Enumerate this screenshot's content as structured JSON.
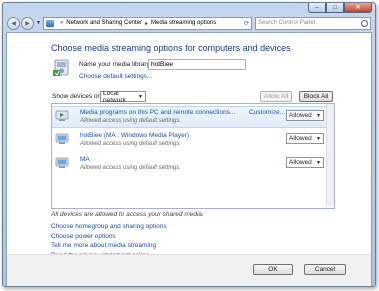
{
  "window": {
    "caption_buttons": [
      "minimize",
      "maximize",
      "close"
    ]
  },
  "navbar": {
    "crumbs": [
      "Network and Sharing Center",
      "Media streaming options"
    ],
    "search_placeholder": "Search Control Panel"
  },
  "main": {
    "heading": "Choose media streaming options for computers and devices",
    "library_label": "Name your media library:",
    "library_value": "hotBiee",
    "defaults_link": "Choose default settings...",
    "show_devices_label": "Show devices on:",
    "show_devices_value": "Local network",
    "allow_all": "Allow All",
    "block_all": "Block All",
    "devices": [
      {
        "name": "Media programs on this PC and remote connections...",
        "status": "Allowed access using default settings.",
        "customize": "Customize...",
        "permission": "Allowed"
      },
      {
        "name": "hotBiee (MA : Windows Media Player)",
        "status": "Allowed access using default settings.",
        "customize": "",
        "permission": "Allowed"
      },
      {
        "name": "MA",
        "status": "Allowed access using default settings.",
        "customize": "",
        "permission": "Allowed"
      }
    ],
    "all_allowed_note": "All devices are allowed to access your shared media.",
    "links": [
      "Choose homegroup and sharing options",
      "Choose power options",
      "Tell me more about media streaming",
      "Read the privacy statement online"
    ]
  },
  "footer": {
    "ok": "OK",
    "cancel": "Cancel"
  },
  "colors": {
    "heading": "#1c3d88",
    "link": "#1e4fb3",
    "frame": "#a9c2de"
  }
}
